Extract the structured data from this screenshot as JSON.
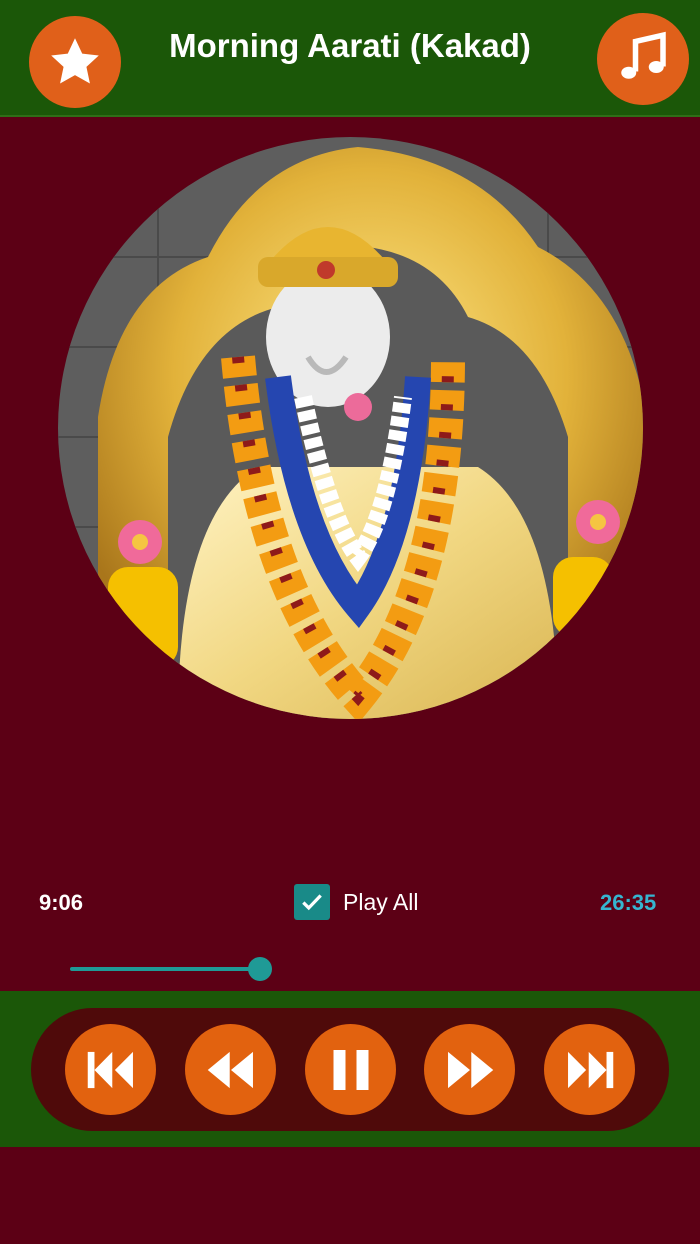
{
  "header": {
    "title": "Morning Aarati (Kakad)",
    "favorite_icon": "star-icon",
    "playlist_icon": "music-note-icon",
    "accent_color": "#e0601a",
    "background_color": "#1b5708"
  },
  "player": {
    "elapsed": "9:06",
    "duration": "26:35",
    "play_all_label": "Play All",
    "play_all_checked": true,
    "progress_fraction": 0.343
  },
  "controls": {
    "buttons": [
      {
        "name": "skip-previous",
        "icon": "skip-previous-icon"
      },
      {
        "name": "rewind",
        "icon": "rewind-icon"
      },
      {
        "name": "pause",
        "icon": "pause-icon"
      },
      {
        "name": "fast-forward",
        "icon": "fast-forward-icon"
      },
      {
        "name": "skip-next",
        "icon": "skip-next-icon"
      }
    ]
  },
  "colors": {
    "page_background": "#5c0015",
    "checkbox": "#198a88",
    "duration_text": "#36b5d0",
    "control_button": "#e2620f"
  }
}
